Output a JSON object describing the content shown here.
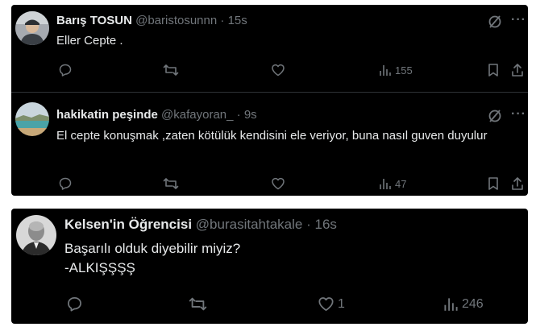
{
  "tweets": [
    {
      "name": "Barış TOSUN",
      "handle": "@baristosunnn",
      "sep": "·",
      "time": "15s",
      "text": "Eller Cepte .",
      "replies": "",
      "retweets": "",
      "likes": "",
      "views": "155",
      "avatar_icon": "person-hat-avatar"
    },
    {
      "name": "hakikatin peşinde",
      "handle": "@kafayoran_",
      "sep": "·",
      "time": "9s",
      "text": "El cepte konuşmak ,zaten kötülük kendisini ele veriyor, buna nasıl guven duyulur",
      "replies": "",
      "retweets": "",
      "likes": "",
      "views": "47",
      "avatar_icon": "lake-landscape-avatar"
    },
    {
      "name": "Kelsen'in Öğrencisi",
      "handle": "@burasitahtakale",
      "sep": "·",
      "time": "16s",
      "text_line1": "Başarılı olduk diyebilir miyiz?",
      "text_line2": "-ALKIŞŞŞŞ",
      "replies": "",
      "retweets": "",
      "likes": "1",
      "views": "246",
      "avatar_icon": "portrait-photo-avatar"
    }
  ],
  "colors": {
    "background": "#000000",
    "text": "#e7e9ea",
    "muted": "#71767b",
    "divider": "#2f3336",
    "page": "#ffffff"
  }
}
